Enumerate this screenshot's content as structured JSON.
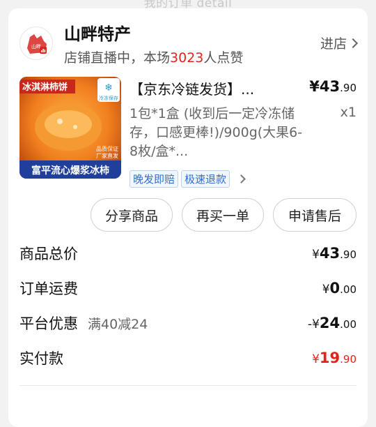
{
  "top_text": "我的订单 detail",
  "store": {
    "name": "山畔特产",
    "live_prefix": "店铺直播中，本场",
    "live_count": "3023",
    "live_suffix": "人点赞",
    "enter_label": "进店"
  },
  "product": {
    "image_badge_top": "冰淇淋柿饼",
    "image_badge_cold": "冷冻保存",
    "image_badge_quality": "品质保证",
    "image_badge_factory": "厂家直发",
    "image_caption": "富平流心爆浆冰柿",
    "title": "【京东冷链发货】...",
    "price_int": "¥43",
    "price_dec": ".90",
    "spec": "1包*1盒 (收到后一定冷冻储存，口感更棒!)/900g(大果6-8枚/盒*...",
    "qty": "x1",
    "tags": [
      "晚发即赔",
      "极速退款"
    ]
  },
  "actions": {
    "share": "分享商品",
    "rebuy": "再买一单",
    "after_sale": "申请售后"
  },
  "summary": {
    "total_label": "商品总价",
    "total_yen": "¥",
    "total_int": "43",
    "total_dec": ".90",
    "shipping_label": "订单运费",
    "shipping_yen": "¥",
    "shipping_int": "0",
    "shipping_dec": ".00",
    "discount_label": "平台优惠",
    "discount_desc": "满40减24",
    "discount_yen": "-¥",
    "discount_int": "24",
    "discount_dec": ".00",
    "paid_label": "实付款",
    "paid_yen": "¥",
    "paid_int": "19",
    "paid_dec": ".90"
  },
  "colors": {
    "accent_red": "#e2231a",
    "tag_blue": "#2f6fd0"
  }
}
